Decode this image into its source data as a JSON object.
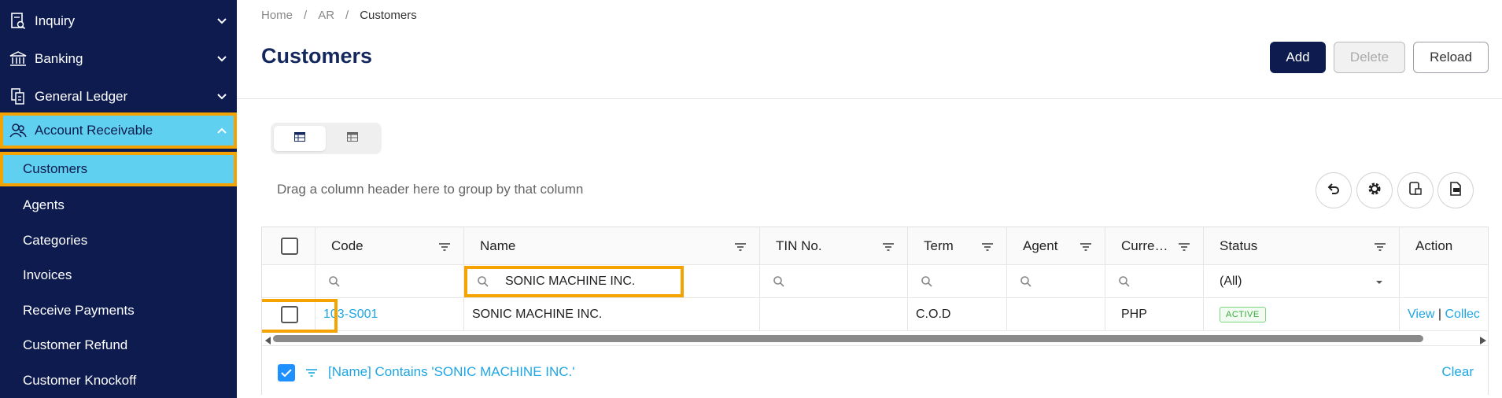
{
  "sidebar": {
    "items": [
      {
        "label": "Inquiry",
        "icon": "inquiry-icon"
      },
      {
        "label": "Banking",
        "icon": "bank-icon"
      },
      {
        "label": "General Ledger",
        "icon": "ledger-icon"
      },
      {
        "label": "Account Receivable",
        "icon": "receivable-icon"
      }
    ],
    "sub_items": [
      "Customers",
      "Agents",
      "Categories",
      "Invoices",
      "Receive Payments",
      "Customer Refund",
      "Customer Knockoff"
    ]
  },
  "breadcrumb": [
    "Home",
    "AR",
    "Customers"
  ],
  "page": {
    "title": "Customers"
  },
  "toolbar": {
    "add": "Add",
    "delete": "Delete",
    "reload": "Reload"
  },
  "grid": {
    "group_hint": "Drag a column header here to group by that column",
    "columns": [
      "Code",
      "Name",
      "TIN No.",
      "Term",
      "Agent",
      "Curre…",
      "Status",
      "Action"
    ],
    "filters": {
      "name": "SONIC MACHINE INC.",
      "status": "(All)"
    },
    "rows": [
      {
        "code": "103-S001",
        "name": "SONIC MACHINE INC.",
        "tin": "",
        "term": "C.O.D",
        "agent": "",
        "currency": "PHP",
        "status": "ACTIVE",
        "action_view": "View",
        "action_sep": "|",
        "action_collect": "Collec"
      }
    ],
    "filter_panel": {
      "text": "[Name] Contains 'SONIC MACHINE INC.'",
      "clear": "Clear"
    }
  },
  "colors": {
    "sidebar": "#0d1b4f",
    "active": "#5fd0ef",
    "highlight": "#f5a300",
    "link": "#1ea7e4",
    "title": "#14285e"
  }
}
